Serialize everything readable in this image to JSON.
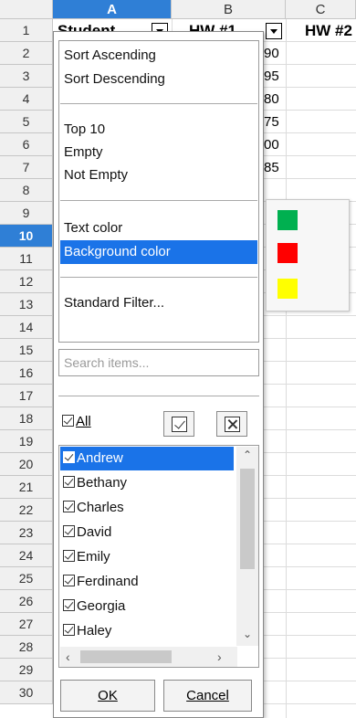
{
  "columns": [
    {
      "letter": "A",
      "active": true
    },
    {
      "letter": "B",
      "active": false
    },
    {
      "letter": "C",
      "active": false
    }
  ],
  "rows": [
    "1",
    "2",
    "3",
    "4",
    "5",
    "6",
    "7",
    "8",
    "9",
    "10",
    "11",
    "12",
    "13",
    "14",
    "15",
    "16",
    "17",
    "18",
    "19",
    "20",
    "21",
    "22",
    "23",
    "24",
    "25",
    "26",
    "27",
    "28",
    "29",
    "30"
  ],
  "active_row": "10",
  "header_cells": {
    "a1": "Student",
    "b1": "HW #1",
    "c1": "HW #2"
  },
  "b_values": [
    "90",
    "95",
    "80",
    "75",
    "00",
    "85"
  ],
  "filter_menu": {
    "sort_asc": "Sort Ascending",
    "sort_desc": "Sort Descending",
    "top10": "Top 10",
    "empty": "Empty",
    "not_empty": "Not Empty",
    "text_color": "Text color",
    "background_color": "Background color",
    "standard_filter": "Standard Filter...",
    "search_placeholder": "Search items...",
    "all_label": "All",
    "items": [
      "Andrew",
      "Bethany",
      "Charles",
      "David",
      "Emily",
      "Ferdinand",
      "Georgia",
      "Haley"
    ],
    "selected_item": "Andrew",
    "ok_label": "OK",
    "cancel_label": "Cancel"
  },
  "color_submenu": {
    "swatches": [
      "#00b050",
      "#ff0000",
      "#ffff00"
    ]
  },
  "colors": {
    "accent": "#1a73e8",
    "header_active": "#2f7fd6"
  }
}
